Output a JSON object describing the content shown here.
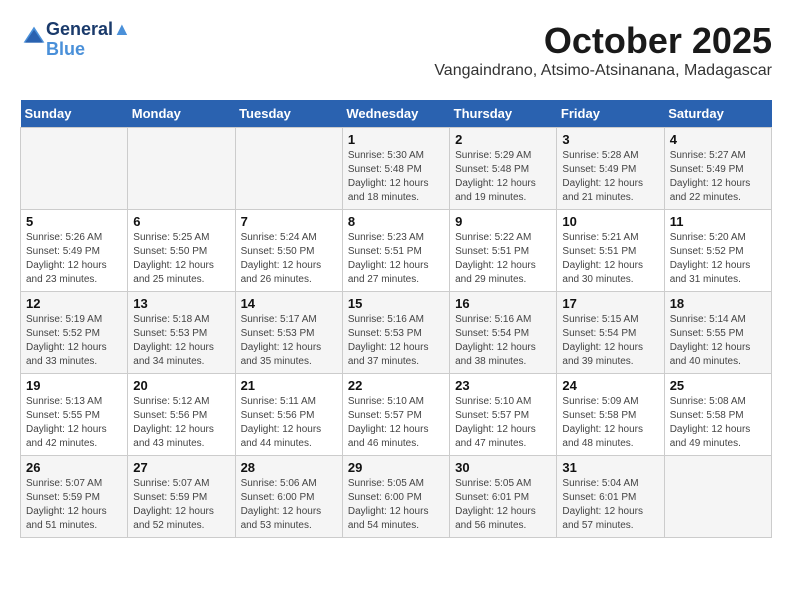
{
  "logo": {
    "line1": "General",
    "line2": "Blue"
  },
  "title": "October 2025",
  "subtitle": "Vangaindrano, Atsimo-Atsinanana, Madagascar",
  "days_header": [
    "Sunday",
    "Monday",
    "Tuesday",
    "Wednesday",
    "Thursday",
    "Friday",
    "Saturday"
  ],
  "weeks": [
    [
      {
        "day": "",
        "content": ""
      },
      {
        "day": "",
        "content": ""
      },
      {
        "day": "",
        "content": ""
      },
      {
        "day": "1",
        "content": "Sunrise: 5:30 AM\nSunset: 5:48 PM\nDaylight: 12 hours\nand 18 minutes."
      },
      {
        "day": "2",
        "content": "Sunrise: 5:29 AM\nSunset: 5:48 PM\nDaylight: 12 hours\nand 19 minutes."
      },
      {
        "day": "3",
        "content": "Sunrise: 5:28 AM\nSunset: 5:49 PM\nDaylight: 12 hours\nand 21 minutes."
      },
      {
        "day": "4",
        "content": "Sunrise: 5:27 AM\nSunset: 5:49 PM\nDaylight: 12 hours\nand 22 minutes."
      }
    ],
    [
      {
        "day": "5",
        "content": "Sunrise: 5:26 AM\nSunset: 5:49 PM\nDaylight: 12 hours\nand 23 minutes."
      },
      {
        "day": "6",
        "content": "Sunrise: 5:25 AM\nSunset: 5:50 PM\nDaylight: 12 hours\nand 25 minutes."
      },
      {
        "day": "7",
        "content": "Sunrise: 5:24 AM\nSunset: 5:50 PM\nDaylight: 12 hours\nand 26 minutes."
      },
      {
        "day": "8",
        "content": "Sunrise: 5:23 AM\nSunset: 5:51 PM\nDaylight: 12 hours\nand 27 minutes."
      },
      {
        "day": "9",
        "content": "Sunrise: 5:22 AM\nSunset: 5:51 PM\nDaylight: 12 hours\nand 29 minutes."
      },
      {
        "day": "10",
        "content": "Sunrise: 5:21 AM\nSunset: 5:51 PM\nDaylight: 12 hours\nand 30 minutes."
      },
      {
        "day": "11",
        "content": "Sunrise: 5:20 AM\nSunset: 5:52 PM\nDaylight: 12 hours\nand 31 minutes."
      }
    ],
    [
      {
        "day": "12",
        "content": "Sunrise: 5:19 AM\nSunset: 5:52 PM\nDaylight: 12 hours\nand 33 minutes."
      },
      {
        "day": "13",
        "content": "Sunrise: 5:18 AM\nSunset: 5:53 PM\nDaylight: 12 hours\nand 34 minutes."
      },
      {
        "day": "14",
        "content": "Sunrise: 5:17 AM\nSunset: 5:53 PM\nDaylight: 12 hours\nand 35 minutes."
      },
      {
        "day": "15",
        "content": "Sunrise: 5:16 AM\nSunset: 5:53 PM\nDaylight: 12 hours\nand 37 minutes."
      },
      {
        "day": "16",
        "content": "Sunrise: 5:16 AM\nSunset: 5:54 PM\nDaylight: 12 hours\nand 38 minutes."
      },
      {
        "day": "17",
        "content": "Sunrise: 5:15 AM\nSunset: 5:54 PM\nDaylight: 12 hours\nand 39 minutes."
      },
      {
        "day": "18",
        "content": "Sunrise: 5:14 AM\nSunset: 5:55 PM\nDaylight: 12 hours\nand 40 minutes."
      }
    ],
    [
      {
        "day": "19",
        "content": "Sunrise: 5:13 AM\nSunset: 5:55 PM\nDaylight: 12 hours\nand 42 minutes."
      },
      {
        "day": "20",
        "content": "Sunrise: 5:12 AM\nSunset: 5:56 PM\nDaylight: 12 hours\nand 43 minutes."
      },
      {
        "day": "21",
        "content": "Sunrise: 5:11 AM\nSunset: 5:56 PM\nDaylight: 12 hours\nand 44 minutes."
      },
      {
        "day": "22",
        "content": "Sunrise: 5:10 AM\nSunset: 5:57 PM\nDaylight: 12 hours\nand 46 minutes."
      },
      {
        "day": "23",
        "content": "Sunrise: 5:10 AM\nSunset: 5:57 PM\nDaylight: 12 hours\nand 47 minutes."
      },
      {
        "day": "24",
        "content": "Sunrise: 5:09 AM\nSunset: 5:58 PM\nDaylight: 12 hours\nand 48 minutes."
      },
      {
        "day": "25",
        "content": "Sunrise: 5:08 AM\nSunset: 5:58 PM\nDaylight: 12 hours\nand 49 minutes."
      }
    ],
    [
      {
        "day": "26",
        "content": "Sunrise: 5:07 AM\nSunset: 5:59 PM\nDaylight: 12 hours\nand 51 minutes."
      },
      {
        "day": "27",
        "content": "Sunrise: 5:07 AM\nSunset: 5:59 PM\nDaylight: 12 hours\nand 52 minutes."
      },
      {
        "day": "28",
        "content": "Sunrise: 5:06 AM\nSunset: 6:00 PM\nDaylight: 12 hours\nand 53 minutes."
      },
      {
        "day": "29",
        "content": "Sunrise: 5:05 AM\nSunset: 6:00 PM\nDaylight: 12 hours\nand 54 minutes."
      },
      {
        "day": "30",
        "content": "Sunrise: 5:05 AM\nSunset: 6:01 PM\nDaylight: 12 hours\nand 56 minutes."
      },
      {
        "day": "31",
        "content": "Sunrise: 5:04 AM\nSunset: 6:01 PM\nDaylight: 12 hours\nand 57 minutes."
      },
      {
        "day": "",
        "content": ""
      }
    ]
  ]
}
